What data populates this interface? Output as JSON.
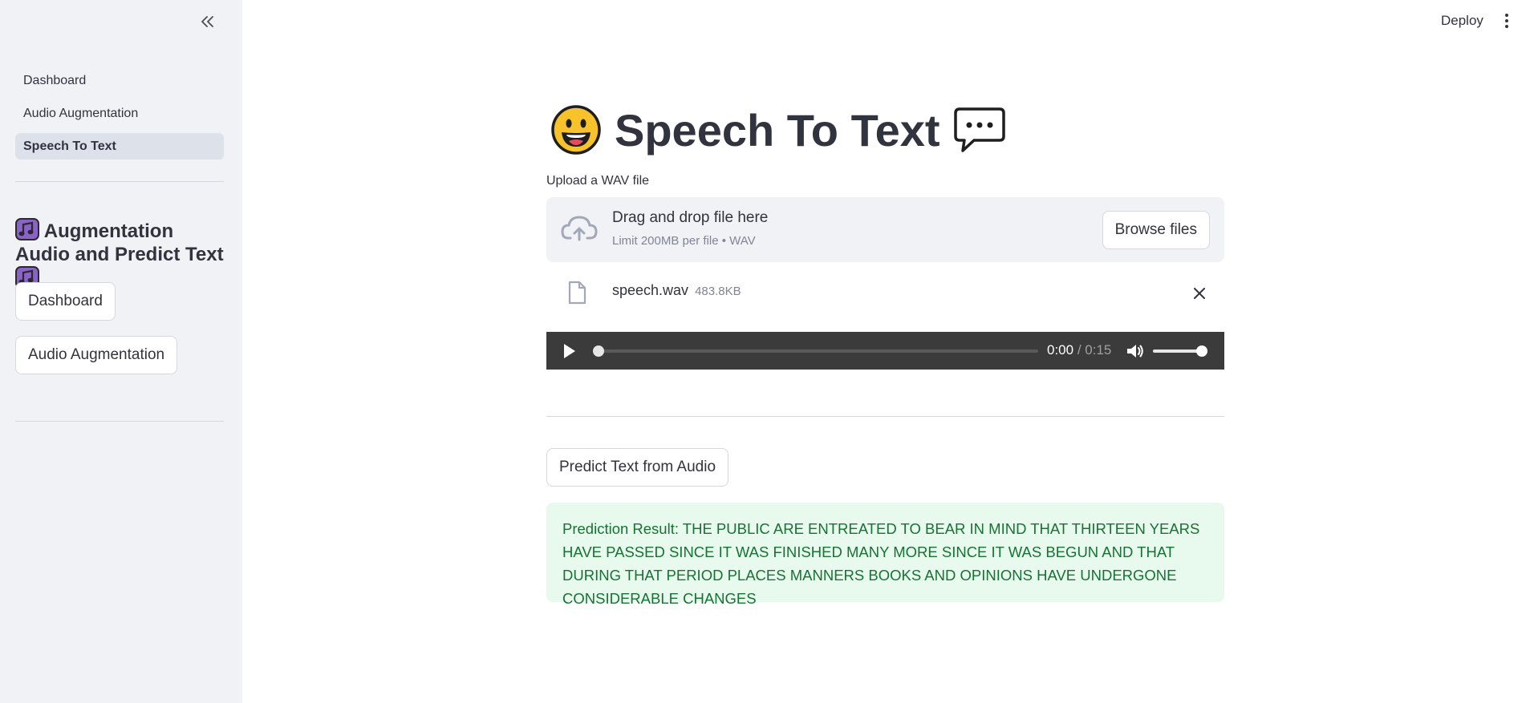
{
  "sidebar": {
    "collapse_glyph": "«",
    "nav": [
      {
        "label": "Dashboard",
        "active": false
      },
      {
        "label": "Audio Augmentation",
        "active": false
      },
      {
        "label": "Speech To Text",
        "active": true
      }
    ],
    "heading": "Augmentation Audio and Predict Text",
    "buttons": [
      {
        "label": "Dashboard"
      },
      {
        "label": "Audio Augmentation"
      }
    ]
  },
  "header": {
    "deploy_label": "Deploy"
  },
  "main": {
    "title": "Speech To Text",
    "uploader": {
      "label": "Upload a WAV file",
      "drag_text": "Drag and drop file here",
      "limit_text": "Limit 200MB per file • WAV",
      "browse_label": "Browse files"
    },
    "file": {
      "name": "speech.wav",
      "size": "483.8KB"
    },
    "audio": {
      "current_time": "0:00",
      "duration": "/ 0:15",
      "progress": 0,
      "volume": 1
    },
    "predict_label": "Predict Text from Audio",
    "result_text": "Prediction Result: THE PUBLIC ARE ENTREATED TO BEAR IN MIND THAT THIRTEEN YEARS HAVE PASSED SINCE IT WAS FINISHED MANY MORE SINCE IT WAS BEGUN AND THAT DURING THAT PERIOD PLACES MANNERS BOOKS AND OPINIONS HAVE UNDERGONE CONSIDERABLE CHANGES"
  },
  "colors": {
    "sidebar_bg": "#f0f2f6",
    "text": "#31333f",
    "success_bg": "#e8f9ee",
    "success_text": "#177233",
    "audio_bg": "#3b3b3b"
  },
  "icons": [
    "collapse-sidebar-icon",
    "kebab-menu-icon",
    "grinning-face-icon",
    "speech-balloon-icon",
    "musical-note-icon",
    "cloud-upload-icon",
    "file-icon",
    "close-icon",
    "play-icon",
    "volume-icon"
  ]
}
